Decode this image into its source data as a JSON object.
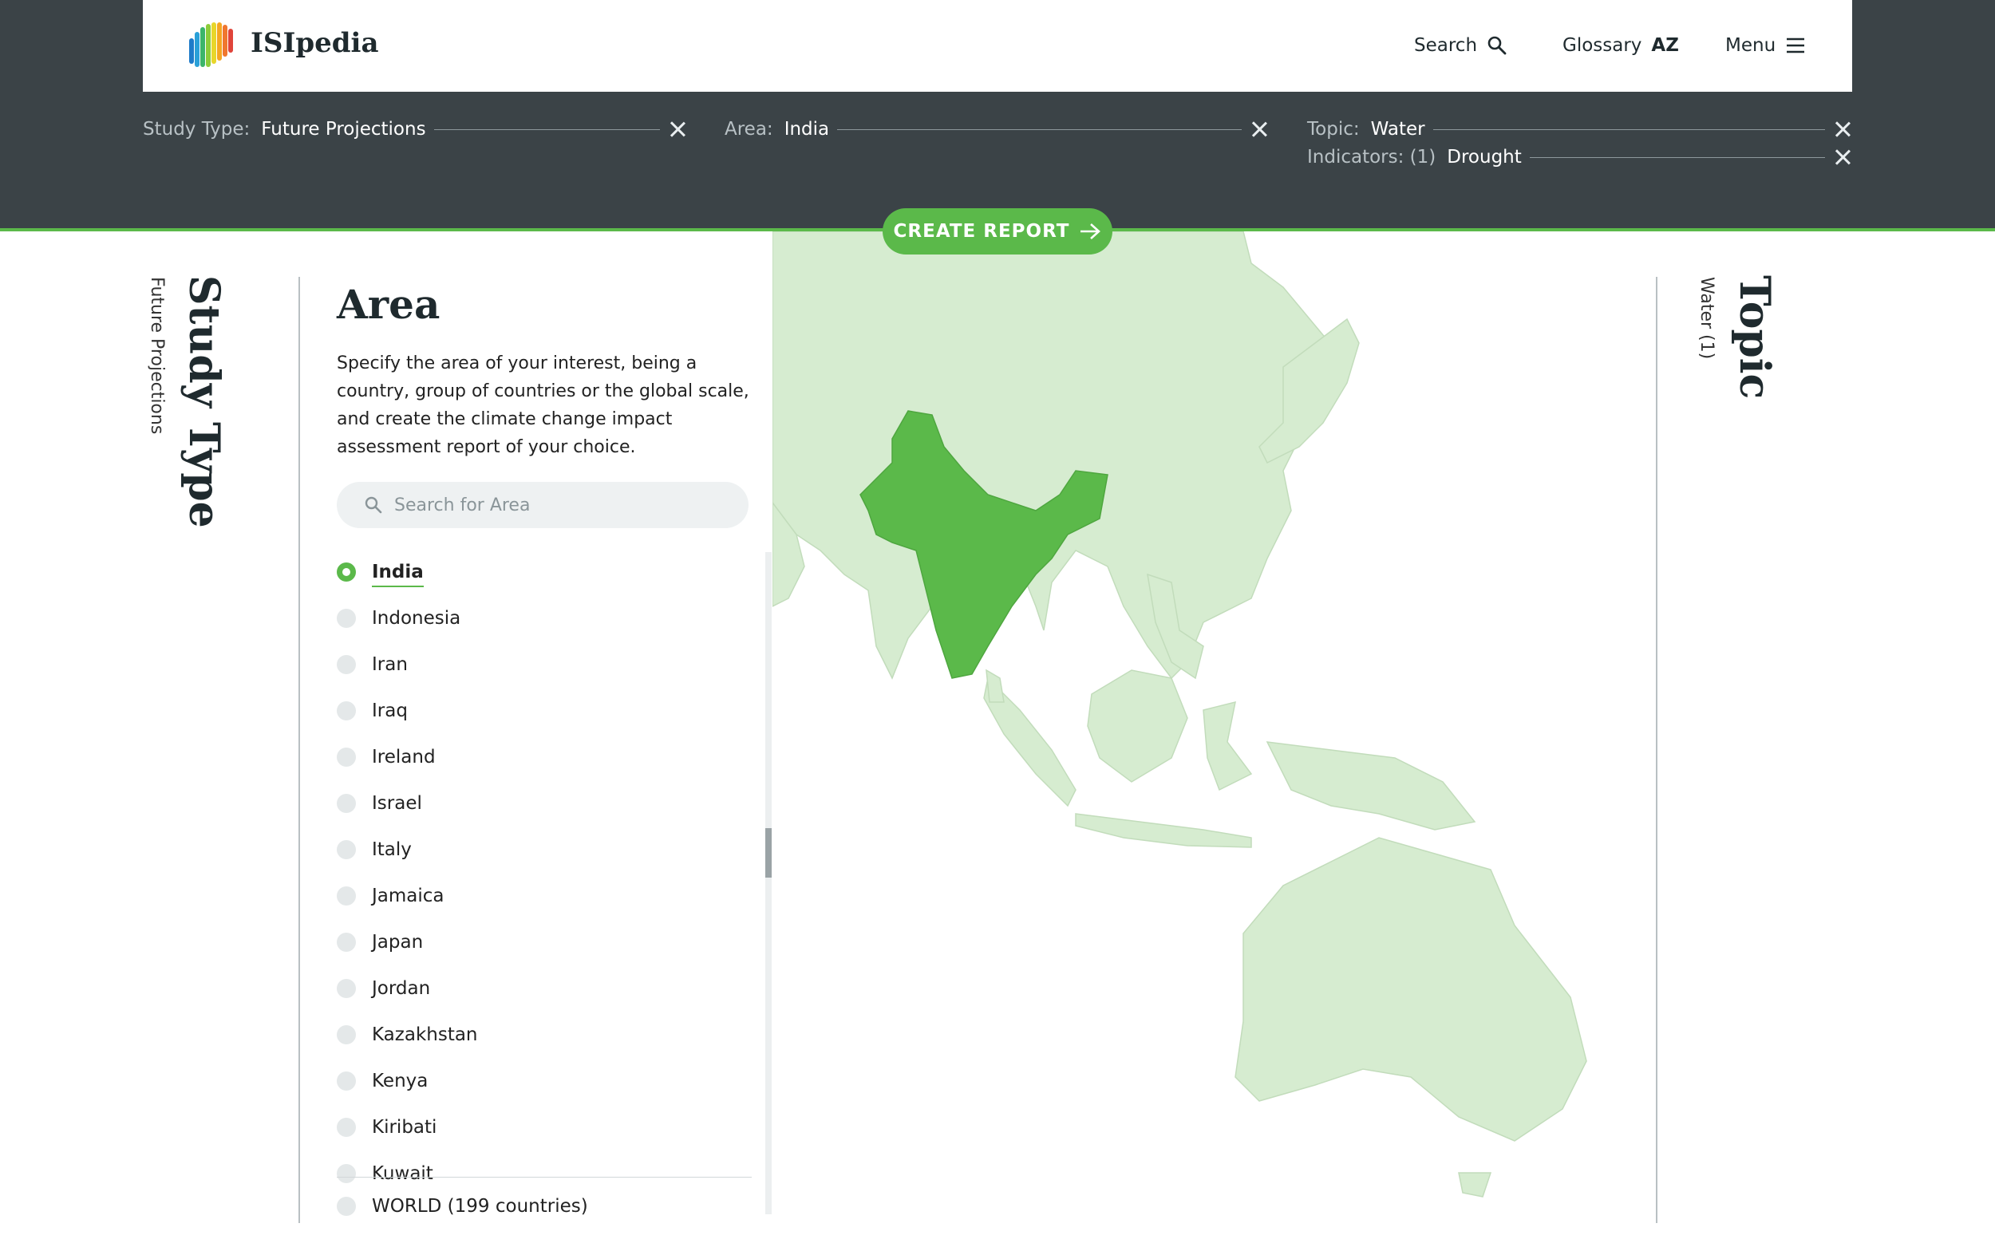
{
  "header": {
    "brand": "ISIpedia",
    "nav": {
      "search": "Search",
      "glossary": "Glossary",
      "glossary_badge": "AZ",
      "menu": "Menu"
    }
  },
  "filters": {
    "study_type": {
      "label": "Study Type:",
      "value": "Future Projections"
    },
    "area": {
      "label": "Area:",
      "value": "India"
    },
    "topic": {
      "label": "Topic:",
      "value": "Water"
    },
    "indicators": {
      "label": "Indicators: (1)",
      "value": "Drought"
    }
  },
  "create_report": "CREATE REPORT",
  "tabs": {
    "study_type": {
      "title": "Study Type",
      "subtitle": "Future Projections"
    },
    "topic": {
      "title": "Topic",
      "subtitle": "Water (1)"
    }
  },
  "area_panel": {
    "title": "Area",
    "description": "Specify the area of your interest, being a country, group of countries or the global scale, and create the climate change impact assessment report of your choice.",
    "search_placeholder": "Search for Area",
    "items": [
      {
        "label": "India",
        "selected": true
      },
      {
        "label": "Indonesia",
        "selected": false
      },
      {
        "label": "Iran",
        "selected": false
      },
      {
        "label": "Iraq",
        "selected": false
      },
      {
        "label": "Ireland",
        "selected": false
      },
      {
        "label": "Israel",
        "selected": false
      },
      {
        "label": "Italy",
        "selected": false
      },
      {
        "label": "Jamaica",
        "selected": false
      },
      {
        "label": "Japan",
        "selected": false
      },
      {
        "label": "Jordan",
        "selected": false
      },
      {
        "label": "Kazakhstan",
        "selected": false
      },
      {
        "label": "Kenya",
        "selected": false
      },
      {
        "label": "Kiribati",
        "selected": false
      },
      {
        "label": "Kuwait",
        "selected": false
      }
    ],
    "world": "WORLD (199 countries)"
  },
  "colors": {
    "dark_band": "#3b4347",
    "accent_green": "#5bb94a",
    "map_land": "#d6ecd0",
    "map_selected": "#5bb94a"
  }
}
